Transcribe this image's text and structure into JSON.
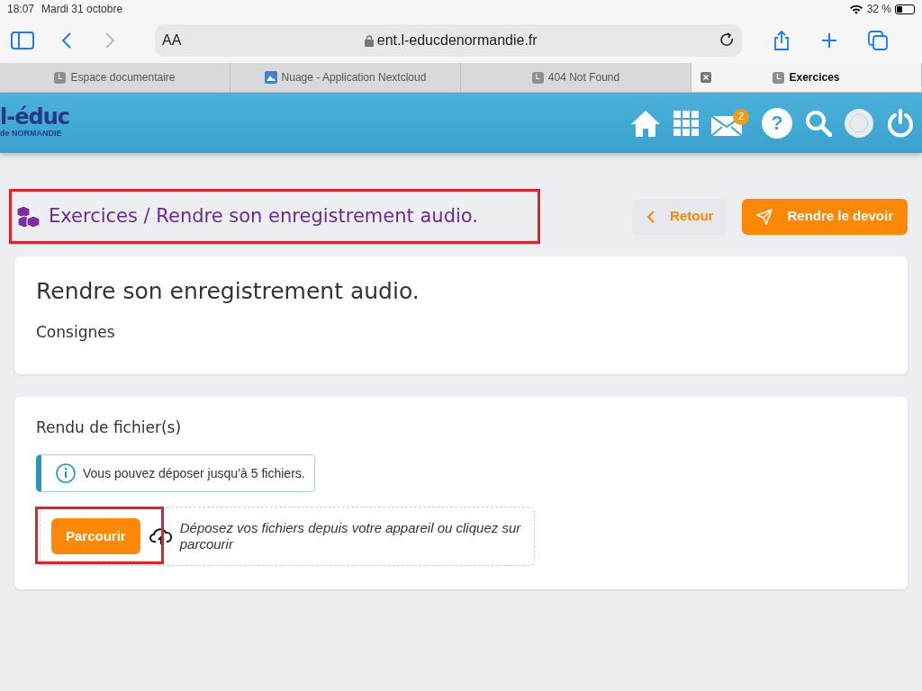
{
  "status_bar": {
    "time": "18:07",
    "date": "Mardi 31 octobre",
    "battery": "32 %"
  },
  "browser": {
    "text_size_button": "AA",
    "url": "ent.l-educdenormandie.fr"
  },
  "tabs": [
    {
      "label": "Espace documentaire",
      "selected": false,
      "kind": "letter",
      "favicon_text": "L"
    },
    {
      "label": "Nuage - Application Nextcloud",
      "selected": false,
      "kind": "image"
    },
    {
      "label": "404 Not Found",
      "selected": false,
      "kind": "letter",
      "favicon_text": "L"
    },
    {
      "label": "Exercices",
      "selected": true,
      "kind": "letter",
      "favicon_text": "L"
    }
  ],
  "header": {
    "logo_main": "l-éduc",
    "logo_sub": "de NORMANDIE",
    "mail_count": "2",
    "help_symbol": "?"
  },
  "page": {
    "breadcrumb": "Exercices / Rendre son enregistrement audio.",
    "back_button": "Retour",
    "submit_button": "Rendre le devoir"
  },
  "assignment": {
    "title": "Rendre son enregistrement audio.",
    "instructions_label": "Consignes"
  },
  "upload": {
    "title": "Rendu de fichier(s)",
    "info": "Vous pouvez déposer jusqu’à 5 fichiers.",
    "browse_button": "Parcourir",
    "drop_hint": "Déposez vos fichiers depuis votre appareil ou cliquez sur parcourir"
  }
}
